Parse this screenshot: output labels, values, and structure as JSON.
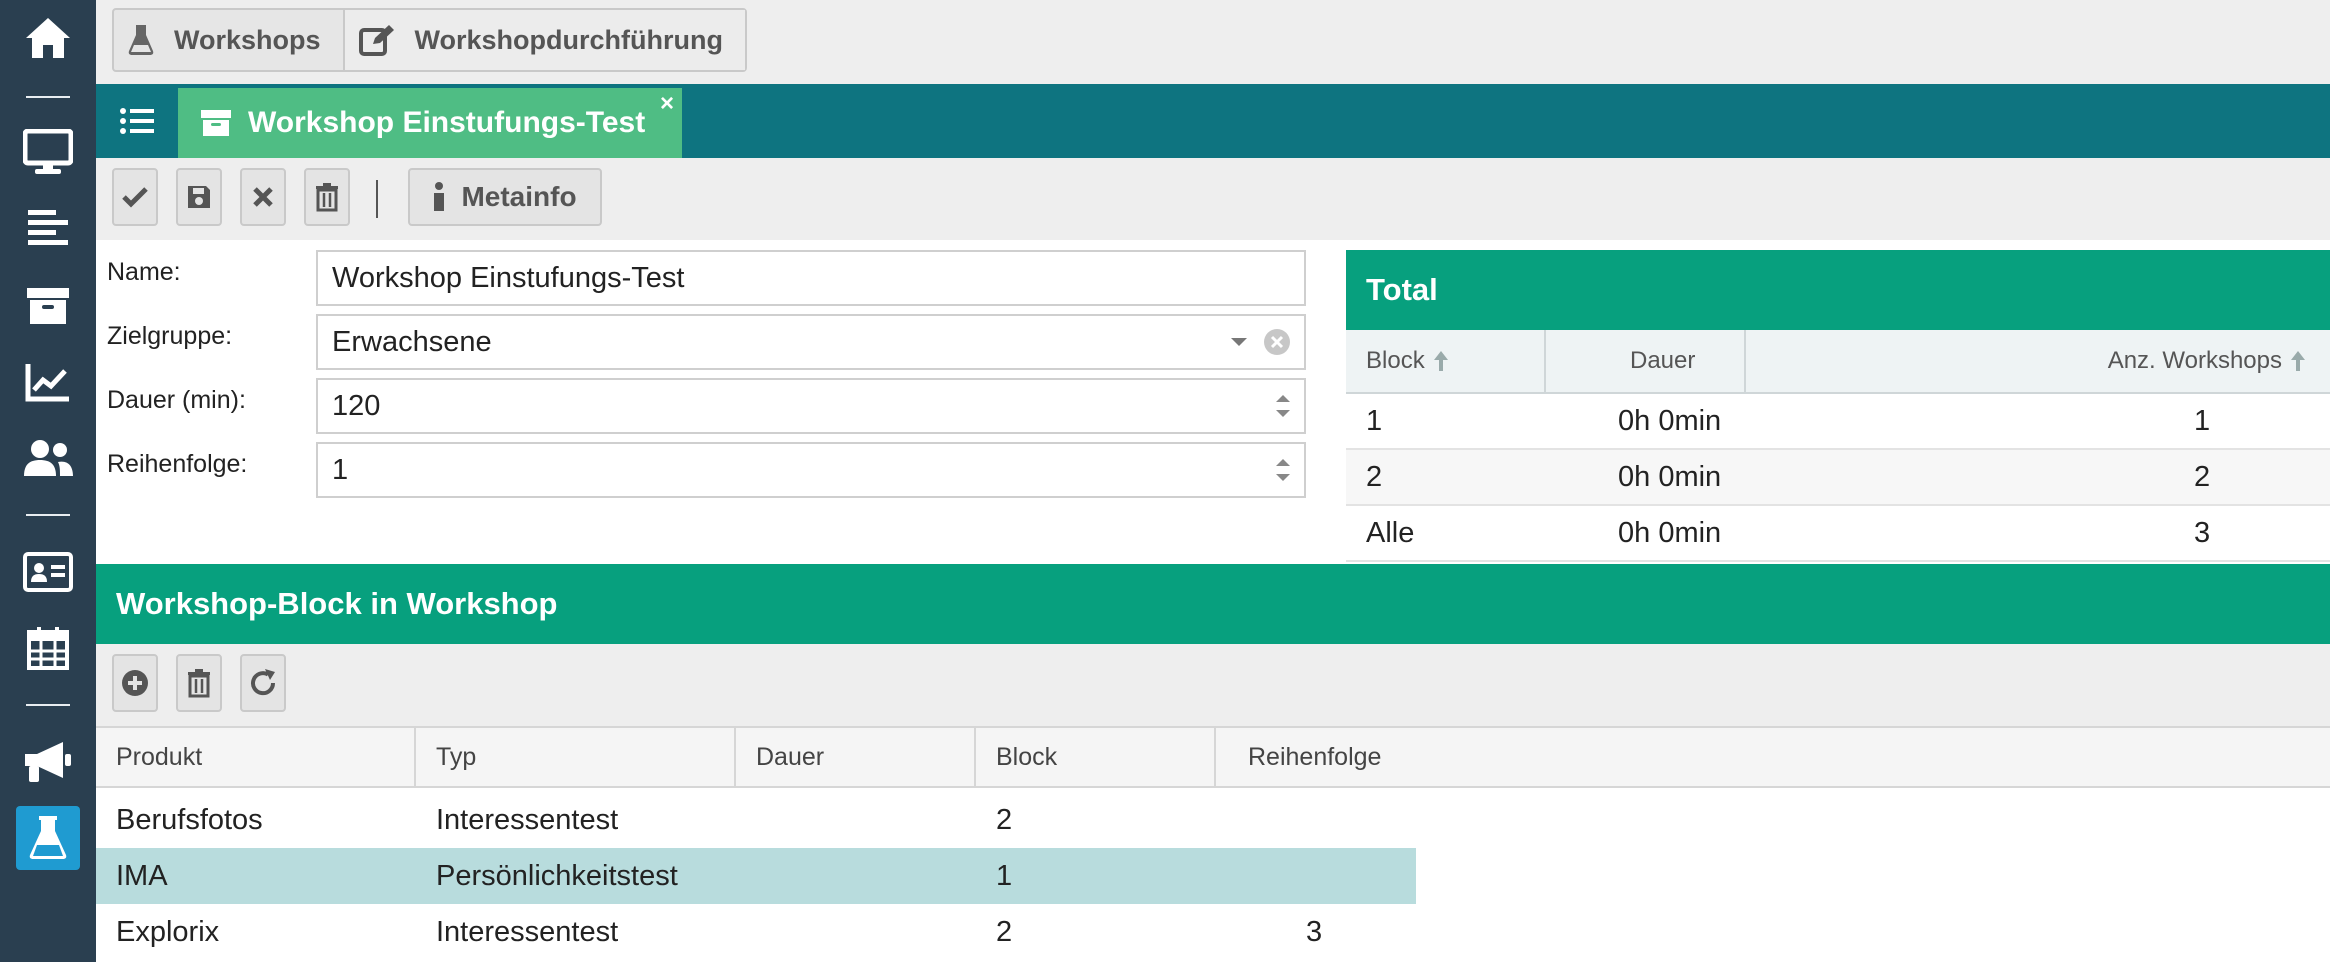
{
  "top_tabs": [
    {
      "label": "Workshops",
      "icon": "flask-icon"
    },
    {
      "label": "Workshopdurchführung",
      "icon": "edit-icon"
    }
  ],
  "doc_tab": {
    "title": "Workshop Einstufungs-Test",
    "close": "×"
  },
  "toolbar": {
    "metainfo_label": "Metainfo"
  },
  "form": {
    "name_label": "Name:",
    "name_value": "Workshop Einstufungs-Test",
    "zielgruppe_label": "Zielgruppe:",
    "zielgruppe_value": "Erwachsene",
    "dauer_label": "Dauer (min):",
    "dauer_value": "120",
    "reihenfolge_label": "Reihenfolge:",
    "reihenfolge_value": "1"
  },
  "total": {
    "title": "Total",
    "columns": [
      "Block",
      "Dauer",
      "Anz. Workshops"
    ],
    "rows": [
      {
        "block": "1",
        "dauer": "0h 0min",
        "anz": "1"
      },
      {
        "block": "2",
        "dauer": "0h 0min",
        "anz": "2"
      },
      {
        "block": "Alle",
        "dauer": "0h 0min",
        "anz": "3"
      }
    ]
  },
  "block_section": {
    "title": "Workshop-Block in Workshop",
    "columns": [
      "Produkt",
      "Typ",
      "Dauer",
      "Block",
      "Reihenfolge"
    ],
    "rows": [
      {
        "produkt": "Berufsfotos",
        "typ": "Interessentest",
        "dauer": "",
        "block": "2",
        "reihenfolge": ""
      },
      {
        "produkt": "IMA",
        "typ": "Persönlichkeitstest",
        "dauer": "",
        "block": "1",
        "reihenfolge": ""
      },
      {
        "produkt": "Explorix",
        "typ": "Interessentest",
        "dauer": "",
        "block": "2",
        "reihenfolge": "3"
      }
    ]
  },
  "colors": {
    "sidebar": "#2a3f50",
    "teal_dark": "#0e7480",
    "green_tab": "#4fbd84",
    "section_header": "#07a07e",
    "selected_row": "#b8dcdd",
    "active_nav": "#1f9bd1"
  }
}
